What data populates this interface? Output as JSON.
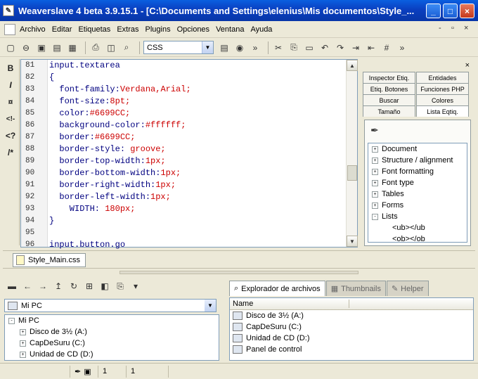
{
  "window": {
    "title": "Weaverslave 4 beta 3.9.15.1 - [C:\\Documents and Settings\\elenius\\Mis documentos\\Style_...",
    "minimize": "_",
    "maximize": "□",
    "close": "×"
  },
  "menu": {
    "items": [
      "Archivo",
      "Editar",
      "Etiquetas",
      "Extras",
      "Plugins",
      "Opciones",
      "Ventana",
      "Ayuda"
    ],
    "mdi_controls": [
      "-",
      "▫",
      "×"
    ]
  },
  "toolbar": {
    "language": "CSS"
  },
  "left_tools": [
    "B",
    "I",
    "¤",
    "<!-",
    "<?",
    "/*"
  ],
  "editor": {
    "lines": [
      {
        "n": "81",
        "code": "input.textarea",
        "val": ""
      },
      {
        "n": "82",
        "code": "{",
        "val": ""
      },
      {
        "n": "83",
        "code": "  font-family:",
        "val": "Verdana,Arial;"
      },
      {
        "n": "84",
        "code": "  font-size:",
        "val": "8pt;"
      },
      {
        "n": "85",
        "code": "  color:",
        "val": "#6699CC;"
      },
      {
        "n": "86",
        "code": "  background-color:",
        "val": "#ffffff;"
      },
      {
        "n": "87",
        "code": "  border:",
        "val": "#6699CC;"
      },
      {
        "n": "88",
        "code": "  border-style: ",
        "val": "groove;"
      },
      {
        "n": "89",
        "code": "  border-top-width:",
        "val": "1px;"
      },
      {
        "n": "90",
        "code": "  border-bottom-width:",
        "val": "1px;"
      },
      {
        "n": "91",
        "code": "  border-right-width:",
        "val": "1px;"
      },
      {
        "n": "92",
        "code": "  border-left-width:",
        "val": "1px;"
      },
      {
        "n": "93",
        "code": "    WIDTH: ",
        "val": "180px;"
      },
      {
        "n": "94",
        "code": "}",
        "val": ""
      },
      {
        "n": "95",
        "code": "",
        "val": ""
      },
      {
        "n": "96",
        "code": "input.button.go",
        "val": ""
      }
    ]
  },
  "right_panel": {
    "close": "×",
    "tabs": [
      "Inspector Etiq.",
      "Entidades",
      "Etiq. Botones",
      "Funciones PHP",
      "Buscar",
      "Colores",
      "Tamaño",
      "Lista Eqtiq."
    ],
    "tree": [
      {
        "sign": "+",
        "label": "Document"
      },
      {
        "sign": "+",
        "label": "Structure / alignment"
      },
      {
        "sign": "+",
        "label": "Font formatting"
      },
      {
        "sign": "+",
        "label": "Font type"
      },
      {
        "sign": "+",
        "label": "Tables"
      },
      {
        "sign": "+",
        "label": "Forms"
      },
      {
        "sign": "-",
        "label": "Lists"
      },
      {
        "sign": "",
        "label": "<ub></ub"
      },
      {
        "sign": "",
        "label": "<ob></ob"
      }
    ]
  },
  "file_tab": "Style_Main.css",
  "explorer_left": {
    "select_value": "Mi PC",
    "tree": [
      {
        "sign": "-",
        "label": "Mi PC"
      },
      {
        "sign": "+",
        "label": "Disco de 3½ (A:)"
      },
      {
        "sign": "+",
        "label": "CapDeSuru (C:)"
      },
      {
        "sign": "+",
        "label": "Unidad de CD (D:)"
      }
    ]
  },
  "explorer_right": {
    "tabs": [
      "Explorador de archivos",
      "Thumbnails",
      "Helper"
    ],
    "column": "Name",
    "items": [
      "Disco de 3½ (A:)",
      "CapDeSuru (C:)",
      "Unidad de CD (D:)",
      "Panel de control"
    ]
  },
  "status": {
    "line": "1",
    "col": "1"
  }
}
